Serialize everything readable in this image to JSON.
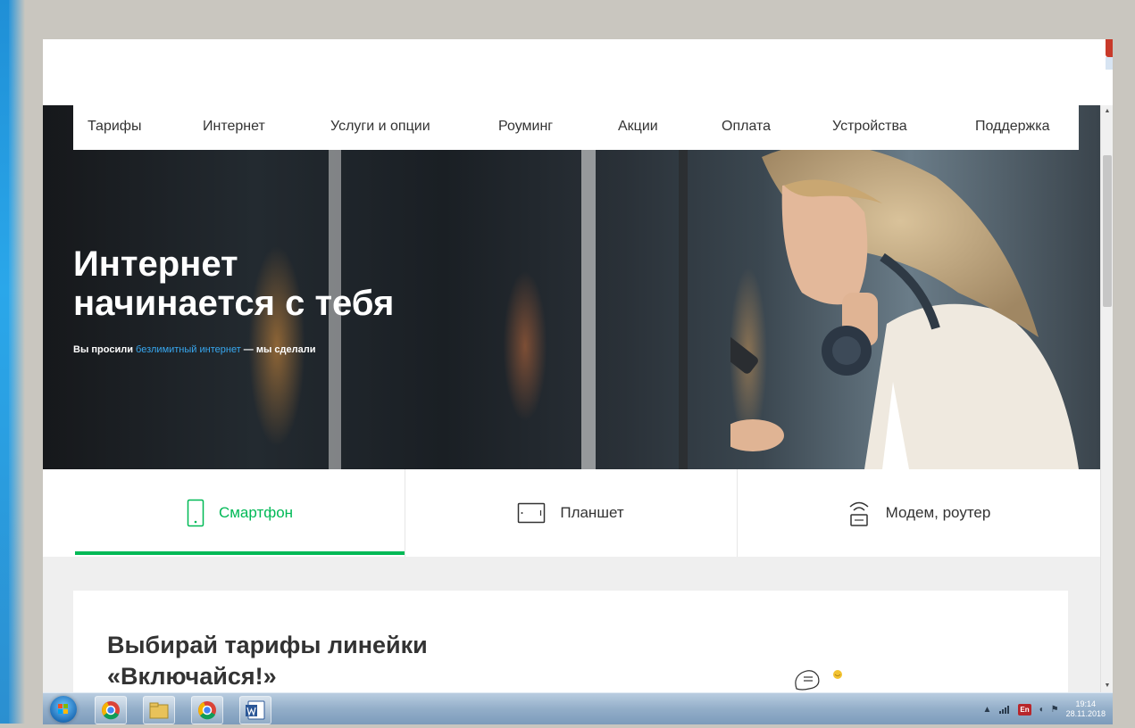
{
  "nav": {
    "items": [
      "Тарифы",
      "Интернет",
      "Услуги и опции",
      "Роуминг",
      "Акции",
      "Оплата",
      "Устройства",
      "Поддержка"
    ]
  },
  "hero": {
    "title_line1": "Интернет",
    "title_line2": "начинается с тебя",
    "subtitle_prefix": "Вы просили ",
    "subtitle_link": "безлимитный интернет",
    "subtitle_suffix": " — мы сделали"
  },
  "device_tabs": {
    "items": [
      {
        "label": "Смартфон",
        "icon": "smartphone-icon",
        "active": true
      },
      {
        "label": "Планшет",
        "icon": "tablet-icon",
        "active": false
      },
      {
        "label": "Модем, роутер",
        "icon": "router-icon",
        "active": false
      }
    ]
  },
  "card": {
    "title_line1": "Выбирай тарифы линейки",
    "title_line2": "«Включайся!»"
  },
  "taskbar": {
    "apps": [
      "chrome-icon",
      "file-explorer-icon",
      "chrome-icon",
      "word-icon"
    ],
    "lang": "En",
    "time": "19:14",
    "date": "28.11.2018"
  },
  "colors": {
    "accent_green": "#00b956",
    "link_blue": "#38a8f0",
    "text_dark": "#333333",
    "taskbar_blue": "#93aec9"
  }
}
